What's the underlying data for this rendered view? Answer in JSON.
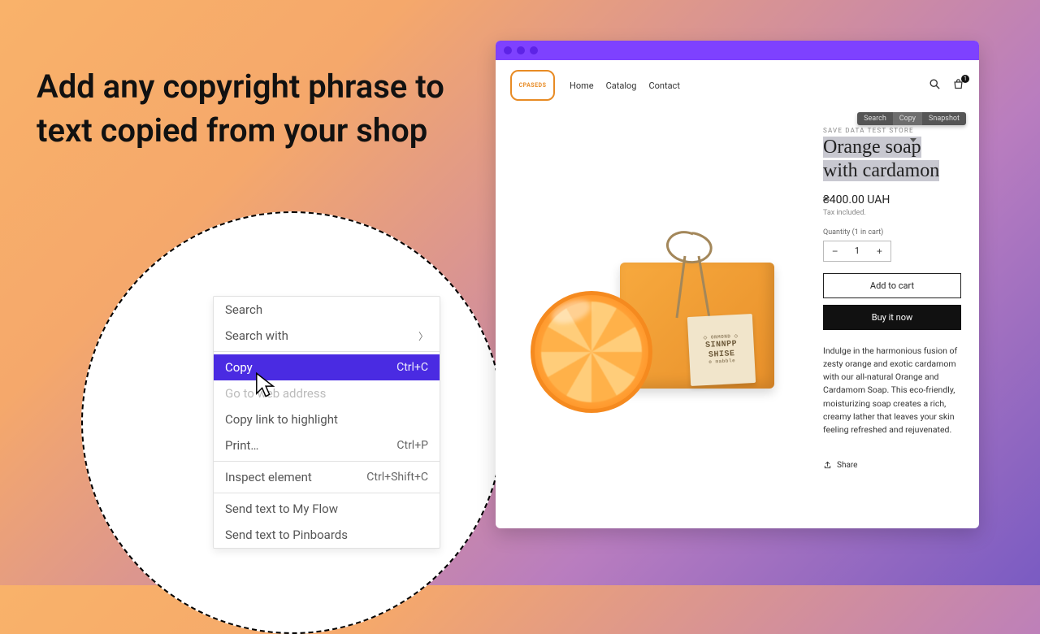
{
  "headline": "Add any copyright phrase to text copied from your shop",
  "context_menu": {
    "search": "Search",
    "search_with": "Search with",
    "copy": "Copy",
    "copy_shortcut": "Ctrl+C",
    "go_to": "Go to web address",
    "copy_link": "Copy link to highlight",
    "print": "Print…",
    "print_shortcut": "Ctrl+P",
    "inspect": "Inspect element",
    "inspect_shortcut": "Ctrl+Shift+C",
    "send_flow": "Send text to My Flow",
    "send_pin": "Send text to Pinboards"
  },
  "selection_toolbar": {
    "search": "Search",
    "copy": "Copy",
    "snapshot": "Snapshot"
  },
  "shop": {
    "logo_text": "CPASEDS",
    "nav": {
      "home": "Home",
      "catalog": "Catalog",
      "contact": "Contact"
    },
    "bag_count": "1"
  },
  "product": {
    "vendor": "SAVE DATA TEST STORE",
    "title_line1": "Orange soap",
    "title_line2": "with cardamon",
    "price": "₴400.00 UAH",
    "tax": "Tax included.",
    "qty_label": "Quantity (1 in cart)",
    "qty_value": "1",
    "add_to_cart": "Add to cart",
    "buy_now": "Buy it now",
    "description": "Indulge in the harmonious fusion of zesty orange and exotic cardamom with our all-natural Orange and Cardamom Soap. This eco-friendly, moisturizing soap creates a rich, creamy lather that leaves your skin feeling refreshed and rejuvenated.",
    "share": "Share",
    "tag_line1": "SINNPP",
    "tag_line2": "SHISE",
    "tag_small": "o mabble"
  }
}
